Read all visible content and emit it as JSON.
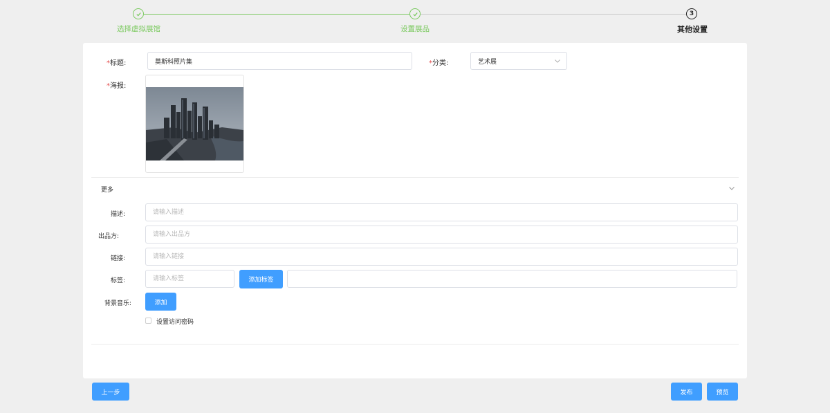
{
  "steps": [
    {
      "label": "选择虚拟展馆",
      "status": "done"
    },
    {
      "label": "设置展品",
      "status": "done"
    },
    {
      "label": "其他设置",
      "number": "3",
      "status": "active"
    }
  ],
  "form": {
    "title_label": "标题:",
    "title_value": "莫斯科照片集",
    "category_label": "分类:",
    "category_value": "艺术展",
    "poster_label": "海报:",
    "required_mark": "*"
  },
  "more": {
    "header": "更多",
    "description_label": "描述:",
    "description_placeholder": "请输入描述",
    "producer_label": "出品方:",
    "producer_placeholder": "请输入出品方",
    "link_label": "链接:",
    "link_placeholder": "请输入链接",
    "tag_label": "标签:",
    "tag_placeholder": "请输入标签",
    "add_tag_button": "添加标签",
    "music_label": "背景音乐:",
    "add_music_button": "添加",
    "password_checkbox_label": "设置访问密码"
  },
  "footer": {
    "prev_button": "上一步",
    "publish_button": "发布",
    "preview_button": "预览"
  },
  "colors": {
    "step_done": "#7ac95e",
    "primary_button": "#409eff",
    "required": "#e34b4b"
  }
}
